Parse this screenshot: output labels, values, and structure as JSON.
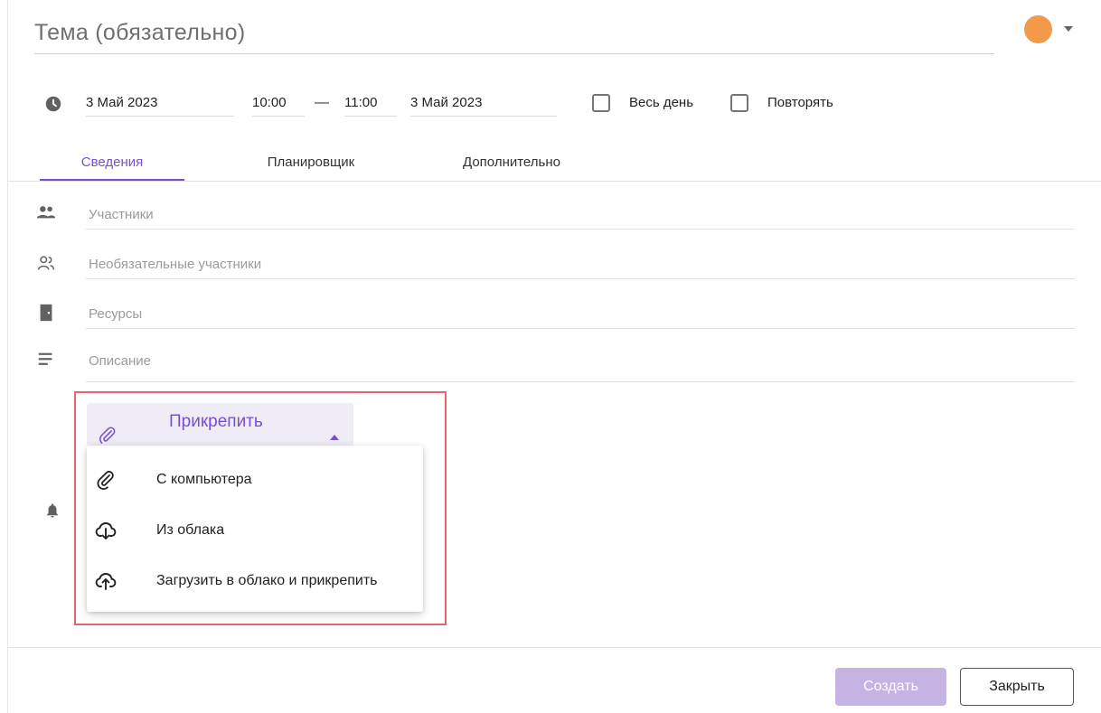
{
  "subject": {
    "placeholder": "Тема (обязательно)"
  },
  "event_color": "#f39a4a",
  "datetime": {
    "start_date": "3 Май 2023",
    "start_time": "10:00",
    "separator": "—",
    "end_time": "11:00",
    "end_date": "3 Май 2023",
    "all_day_label": "Весь день",
    "repeat_label": "Повторять"
  },
  "tabs": [
    {
      "label": "Сведения",
      "active": true
    },
    {
      "label": "Планировщик",
      "active": false
    },
    {
      "label": "Дополнительно",
      "active": false
    }
  ],
  "fields": {
    "participants_placeholder": "Участники",
    "optional_participants_placeholder": "Необязательные участники",
    "resources_placeholder": "Ресурсы",
    "description_placeholder": "Описание"
  },
  "attach": {
    "label": "Прикрепить",
    "menu": [
      {
        "label": "С компьютера",
        "icon": "paperclip-icon"
      },
      {
        "label": "Из облака",
        "icon": "cloud-download-icon"
      },
      {
        "label": "Загрузить в облако и прикрепить",
        "icon": "cloud-upload-icon"
      }
    ]
  },
  "footer": {
    "create_label": "Создать",
    "close_label": "Закрыть"
  },
  "colors": {
    "accent": "#7a4fcf",
    "highlight_border": "#e8636d",
    "create_disabled": "#c5b3e2"
  }
}
